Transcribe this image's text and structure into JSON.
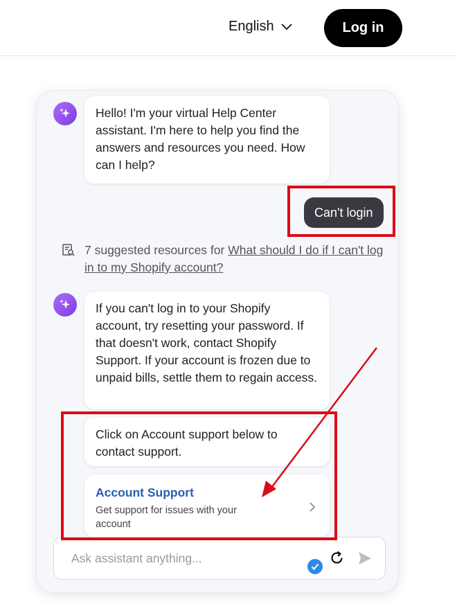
{
  "header": {
    "language": "English",
    "login_label": "Log in"
  },
  "chat": {
    "greeting": "Hello! I'm your virtual Help Center assistant. I'm here to help you find the answers and resources you need. How can I help?",
    "user_message": "Can't login",
    "resources_prefix": "7 suggested resources for",
    "resources_link": "What should I do if I can't log in to my Shopify account?",
    "answer": "If you can't log in to your Shopify account, try resetting your password. If that doesn't work, contact Shopify Support. If your account is frozen due to unpaid bills, settle them to regain access.",
    "followup": "Click on Account support below to contact support.",
    "support_card": {
      "title": "Account Support",
      "description": "Get support for issues with your account"
    },
    "input_placeholder": "Ask assistant anything..."
  },
  "colors": {
    "annotation": "#dd0a17",
    "user_bubble": "#3b3841",
    "link_blue": "#2a5db0",
    "avatar": "#8a4ce8"
  },
  "icons": [
    "chevron-down-icon",
    "sparkle-icon",
    "resources-search-icon",
    "chevron-right-icon",
    "chevron-left-icon",
    "check-icon",
    "refresh-icon",
    "send-icon"
  ]
}
